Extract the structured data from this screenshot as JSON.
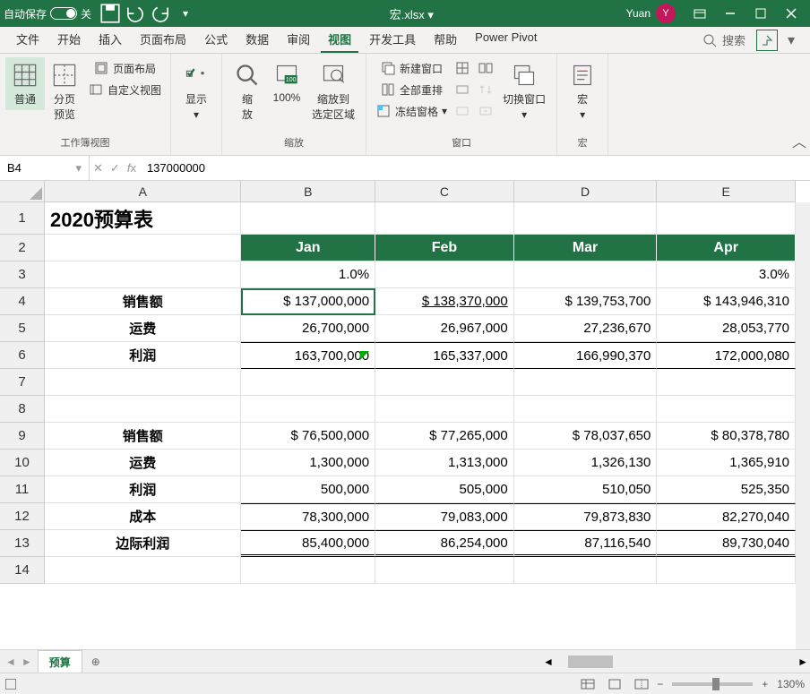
{
  "titlebar": {
    "autosave_label": "自动保存",
    "autosave_state": "关",
    "filename": "宏.xlsx ▾",
    "username": "Yuan",
    "user_initial": "Y"
  },
  "tabs": {
    "items": [
      "文件",
      "开始",
      "插入",
      "页面布局",
      "公式",
      "数据",
      "审阅",
      "视图",
      "开发工具",
      "帮助",
      "Power Pivot"
    ],
    "active": 7,
    "search": "搜索"
  },
  "ribbon": {
    "g1_label": "工作簿视图",
    "normal": "普通",
    "pagebreak": "分页\n预览",
    "pagelayout": "页面布局",
    "custom": "自定义视图",
    "g2_label": "",
    "show": "显示",
    "g3_label": "缩放",
    "zoom": "缩\n放",
    "zoom100": "100%",
    "zoomsel": "缩放到\n选定区域",
    "g4_label": "窗口",
    "newwin": "新建窗口",
    "arrange": "全部重排",
    "freeze": "冻结窗格",
    "switchwin": "切换窗口",
    "g5_label": "宏",
    "macros": "宏"
  },
  "formula": {
    "cellref": "B4",
    "value": "137000000"
  },
  "grid": {
    "cols": [
      "A",
      "B",
      "C",
      "D",
      "E"
    ],
    "title": "2020预算表",
    "months": [
      "Jan",
      "Feb",
      "Mar",
      "Apr"
    ],
    "row3": [
      "1.0%",
      "",
      "",
      "3.0%"
    ],
    "labels1": [
      "销售额",
      "运费",
      "利润"
    ],
    "block1": [
      [
        "$ 137,000,000",
        "$    138,370,000",
        "$   139,753,700",
        "$   143,946,310"
      ],
      [
        "26,700,000",
        "26,967,000",
        "27,236,670",
        "28,053,770"
      ],
      [
        "163,700,000",
        "165,337,000",
        "166,990,370",
        "172,000,080"
      ]
    ],
    "labels2": [
      "销售额",
      "运费",
      "利润",
      "成本",
      "边际利润"
    ],
    "block2": [
      [
        "$     76,500,000",
        "$      77,265,000",
        "$     78,037,650",
        "$     80,378,780"
      ],
      [
        "1,300,000",
        "1,313,000",
        "1,326,130",
        "1,365,910"
      ],
      [
        "500,000",
        "505,000",
        "510,050",
        "525,350"
      ],
      [
        "78,300,000",
        "79,083,000",
        "79,873,830",
        "82,270,040"
      ],
      [
        "85,400,000",
        "86,254,000",
        "87,116,540",
        "89,730,040"
      ]
    ]
  },
  "sheet": {
    "name": "预算"
  },
  "status": {
    "zoom": "130%"
  }
}
